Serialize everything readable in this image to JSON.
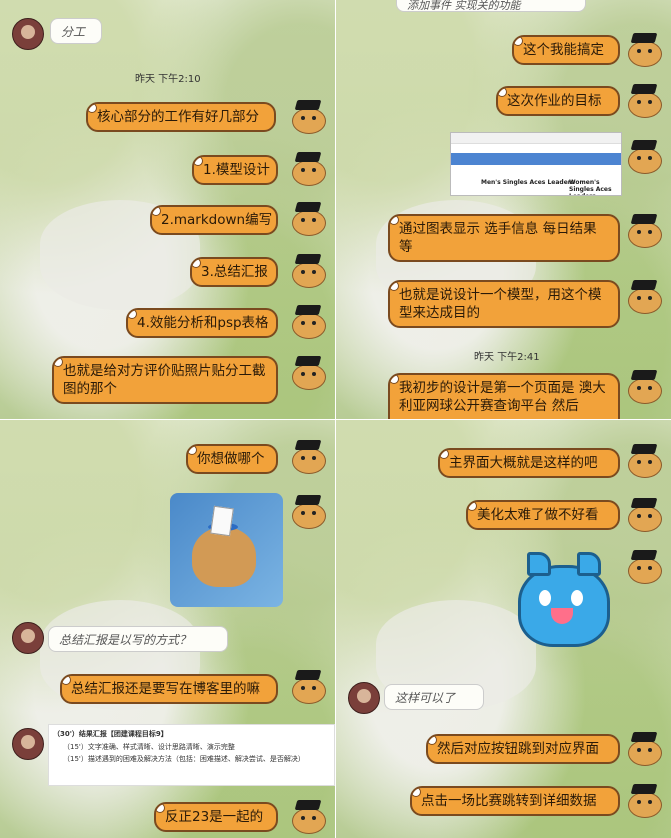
{
  "p1": {
    "top_note": "分工",
    "timestamp": "昨天 下午2:10",
    "messages": [
      "核心部分的工作有好几部分",
      "1.模型设计",
      "2.markdown编写",
      "3.总结汇报",
      "4.效能分析和psp表格",
      "也就是给对方评价贴照片贴分工截图的那个"
    ]
  },
  "p2": {
    "top_note": "添加事件 实现关的功能",
    "messages": [
      "这个我能搞定",
      "这次作业的目标",
      "通过图表显示 选手信息 每日结果等",
      "也就是说设计一个模型，用这个模型来达成目的",
      "我初步的设计是第一个页面是 澳大利亚网球公开赛查询平台 然后"
    ],
    "timestamp": "昨天 下午2:41",
    "shot": {
      "col1": "Men's Singles Aces Leaders",
      "col2": "Women's Singles Aces Leaders"
    }
  },
  "p3": {
    "messages": [
      "你想做哪个",
      "总结汇报还是要写在博客里的嘛",
      "反正23是一起的"
    ],
    "note": "总结汇报是以写的方式？",
    "card": {
      "title": "（30'）结果汇报【团建课程目标9】",
      "items": [
        "（15'）文字准确、样式清晰、设计思路清晰、演示完整",
        "（15'）描述遇到的困难及解决方法（包括：困难描述、解决尝试、是否解决）"
      ]
    }
  },
  "p4": {
    "messages": [
      "主界面大概就是这样的吧",
      "美化太难了做不好看",
      "然后对应按钮跳到对应界面",
      "点击一场比赛跳转到详细数据"
    ],
    "note": "这样可以了"
  },
  "colors": {
    "bubble": "#f2a23a",
    "bubble_border": "#7a4a1f"
  }
}
